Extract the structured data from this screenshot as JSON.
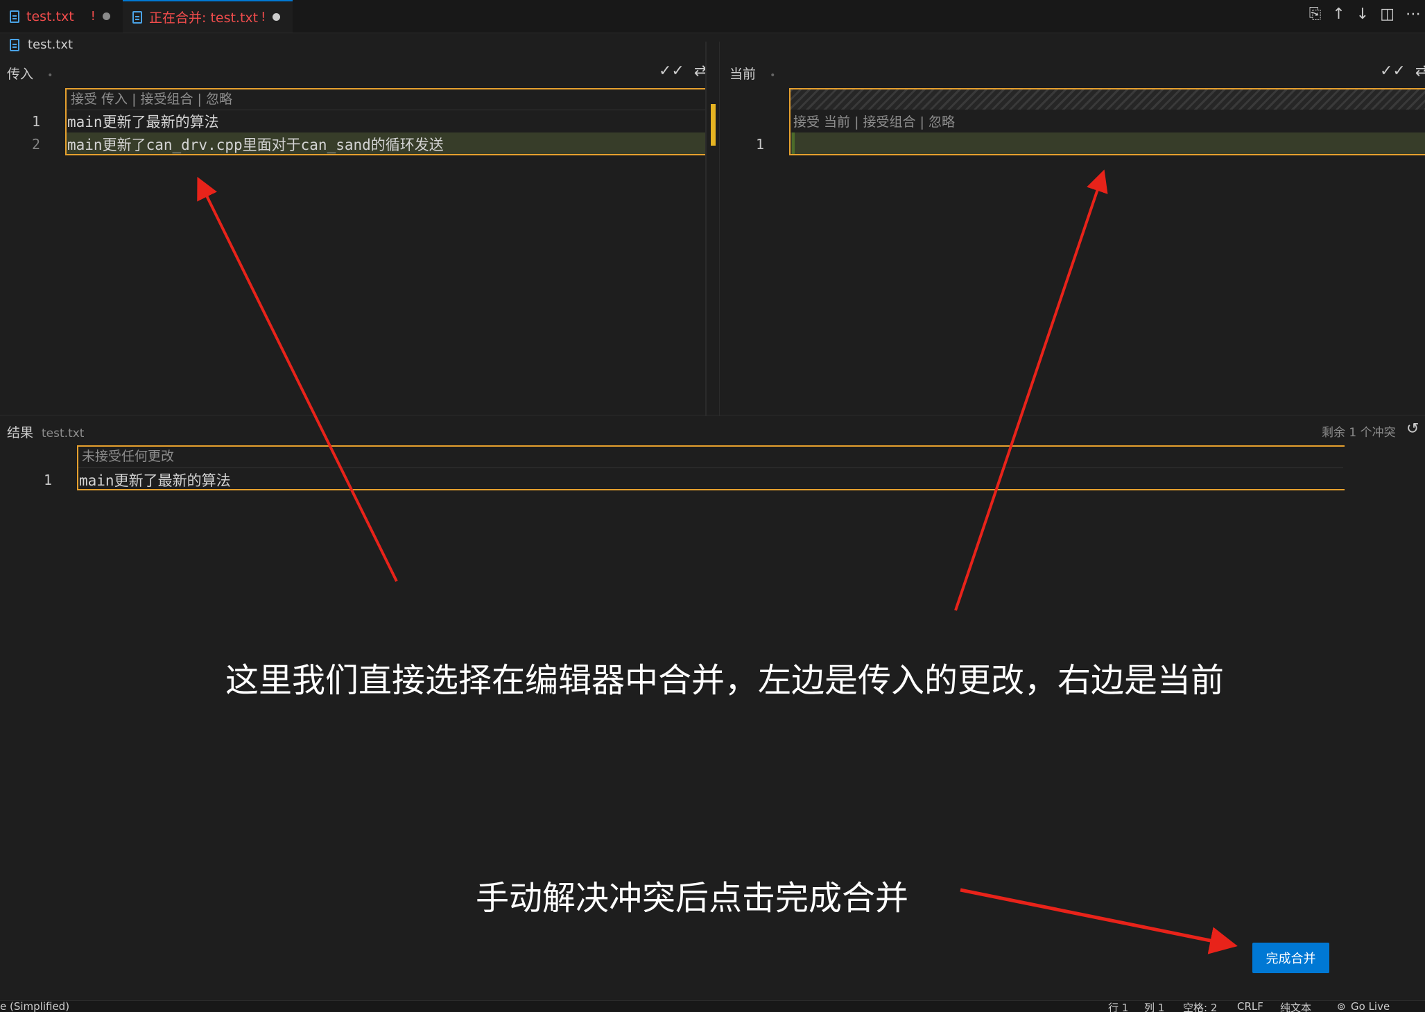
{
  "tabs": [
    {
      "label": "test.txt",
      "status": "!"
    },
    {
      "label": "正在合并: test.txt",
      "status": "!"
    }
  ],
  "breadcrumb": {
    "file": "test.txt"
  },
  "incoming": {
    "title": "传入",
    "codelens": "接受 传入 | 接受组合 | 忽略",
    "lines": [
      {
        "num": "1",
        "text": "main更新了最新的算法"
      },
      {
        "num": "2",
        "text": "main更新了can_drv.cpp里面对于can_sand的循环发送"
      }
    ]
  },
  "current": {
    "title": "当前",
    "codelens": "接受 当前 | 接受组合 | 忽略",
    "lines": [
      {
        "num": "1",
        "text": ""
      }
    ]
  },
  "result": {
    "title": "结果",
    "file": "test.txt",
    "remaining": "剩余 1 个冲突",
    "codelens": "未接受任何更改",
    "lines": [
      {
        "num": "1",
        "text": "main更新了最新的算法"
      }
    ]
  },
  "annotations": {
    "caption1": "这里我们直接选择在编辑器中合并，左边是传入的更改，右边是当前",
    "caption2": "手动解决冲突后点击完成合并"
  },
  "complete_button": "完成合并",
  "statusbar": {
    "left": "e (Simplified)",
    "line": "行 1",
    "col": "列 1",
    "spaces": "空格: 2",
    "eol": "CRLF",
    "lang": "纯文本",
    "golive": "Go Live"
  },
  "colors": {
    "accent": "#0078d4",
    "conflict": "#e6a02e",
    "error": "#f14c4c",
    "arrow": "#e8231a"
  }
}
